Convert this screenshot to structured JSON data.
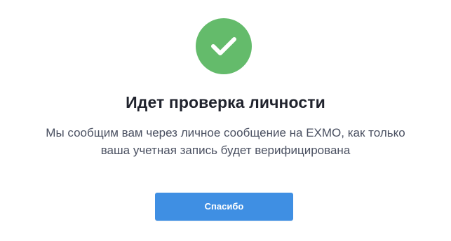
{
  "icon": {
    "name": "check-icon",
    "background_color": "#64bb6b",
    "check_color": "#ffffff"
  },
  "title": "Идет проверка личности",
  "message": {
    "line1": "Мы сообщим вам через личное сообщение на EXMO, как только",
    "line2": "ваша учетная запись будет верифицирована"
  },
  "button": {
    "label": "Спасибо",
    "color": "#3f8fe3"
  }
}
